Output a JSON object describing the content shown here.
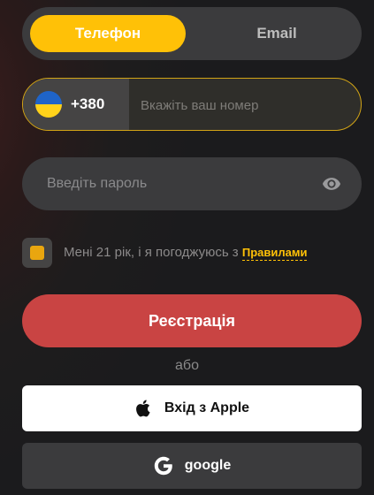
{
  "tabs": {
    "phone_label": "Телефон",
    "email_label": "Email",
    "active": "phone"
  },
  "phone": {
    "country_code": "+380",
    "country_flag": "ukraine-flag-icon",
    "placeholder": "Вкажіть ваш номер",
    "value": ""
  },
  "password": {
    "placeholder": "Введіть пароль",
    "value": "",
    "toggle_icon": "eye-icon"
  },
  "agreement": {
    "text": "Мені 21 рік, і я погоджуюсь з ",
    "link_label": "Правилами"
  },
  "register_label": "Реєстрація",
  "or_label": "або",
  "social": {
    "apple_label": "Вхід з Apple",
    "google_label": "google"
  },
  "colors": {
    "accent": "#ffc107",
    "register": "#c94443",
    "field_bg": "#3b3b3d"
  }
}
